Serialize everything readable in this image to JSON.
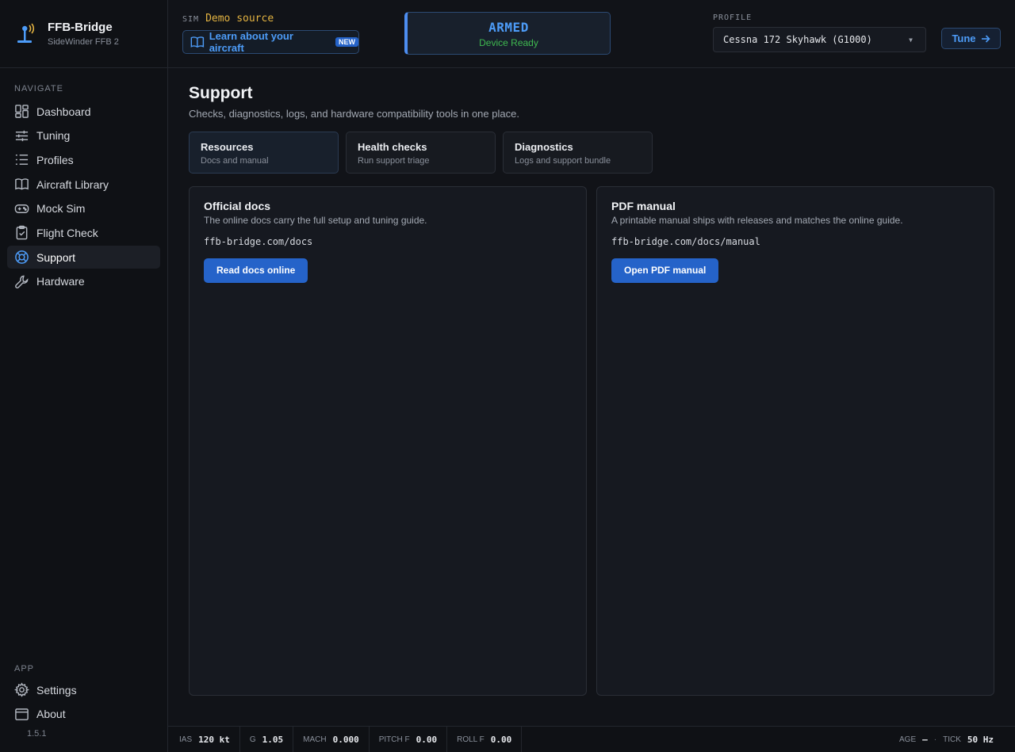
{
  "brand": {
    "title": "FFB-Bridge",
    "subtitle": "SideWinder FFB 2"
  },
  "nav": {
    "heading": "NAVIGATE",
    "items": [
      {
        "label": "Dashboard",
        "icon": "dashboard-icon"
      },
      {
        "label": "Tuning",
        "icon": "sliders-icon"
      },
      {
        "label": "Profiles",
        "icon": "list-icon"
      },
      {
        "label": "Aircraft Library",
        "icon": "book-icon"
      },
      {
        "label": "Mock Sim",
        "icon": "gamepad-icon"
      },
      {
        "label": "Flight Check",
        "icon": "clipboard-check-icon"
      },
      {
        "label": "Support",
        "icon": "lifebuoy-icon",
        "active": true
      },
      {
        "label": "Hardware",
        "icon": "wrench-icon"
      }
    ]
  },
  "app": {
    "heading": "APP",
    "items": [
      {
        "label": "Settings",
        "icon": "gear-icon"
      },
      {
        "label": "About",
        "icon": "window-icon"
      }
    ],
    "version": "1.5.1"
  },
  "header": {
    "sim_label": "SIM",
    "sim_value": "Demo source",
    "learn_label": "Learn about your aircraft",
    "learn_badge": "NEW",
    "status_title": "ARMED",
    "status_sub": "Device Ready",
    "profile_label": "PROFILE",
    "profile_value": "Cessna 172 Skyhawk (G1000)",
    "tune_label": "Tune"
  },
  "page": {
    "title": "Support",
    "subtitle": "Checks, diagnostics, logs, and hardware compatibility tools in one place.",
    "tabs": [
      {
        "title": "Resources",
        "sub": "Docs and manual"
      },
      {
        "title": "Health checks",
        "sub": "Run support triage"
      },
      {
        "title": "Diagnostics",
        "sub": "Logs and support bundle"
      }
    ],
    "cards": [
      {
        "title": "Official docs",
        "desc": "The online docs carry the full setup and tuning guide.",
        "url": "ffb-bridge.com/docs",
        "button": "Read docs online"
      },
      {
        "title": "PDF manual",
        "desc": "A printable manual ships with releases and matches the online guide.",
        "url": "ffb-bridge.com/docs/manual",
        "button": "Open PDF manual"
      }
    ]
  },
  "status": {
    "ias_label": "IAS",
    "ias_value": "120 kt",
    "g_label": "G",
    "g_value": "1.05",
    "mach_label": "MACH",
    "mach_value": "0.000",
    "pitch_label": "PITCH F",
    "pitch_value": "0.00",
    "roll_label": "ROLL F",
    "roll_value": "0.00",
    "age_label": "AGE",
    "age_value": "—",
    "sep": "·",
    "tick_label": "TICK",
    "tick_value": "50 Hz"
  },
  "colors": {
    "accent": "#4d9cf8",
    "primary_button": "#2563c9",
    "sim_value": "#e3b341",
    "ready_green": "#3fb950"
  }
}
